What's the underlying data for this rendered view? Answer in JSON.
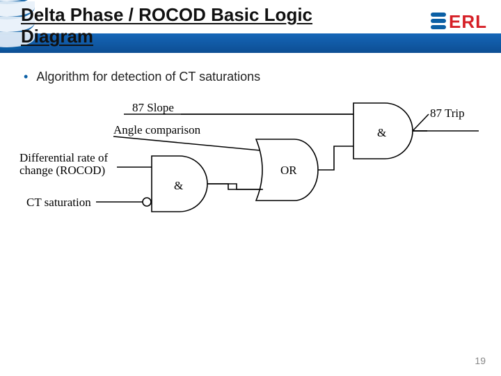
{
  "slide": {
    "title": "Delta Phase / ROCOD Basic Logic Diagram",
    "bullet": "Algorithm for detection of CT saturations",
    "page_number": "19"
  },
  "logo": {
    "text": "ERL"
  },
  "diagram": {
    "signals": {
      "slope": "87 Slope",
      "angle": "Angle comparison",
      "rocod_line1": "Differential rate of",
      "rocod_line2": "change (ROCOD)",
      "ct_sat": "CT saturation",
      "output": "87 Trip"
    },
    "gates": {
      "and1": "&",
      "or": "OR",
      "and2": "&"
    }
  }
}
